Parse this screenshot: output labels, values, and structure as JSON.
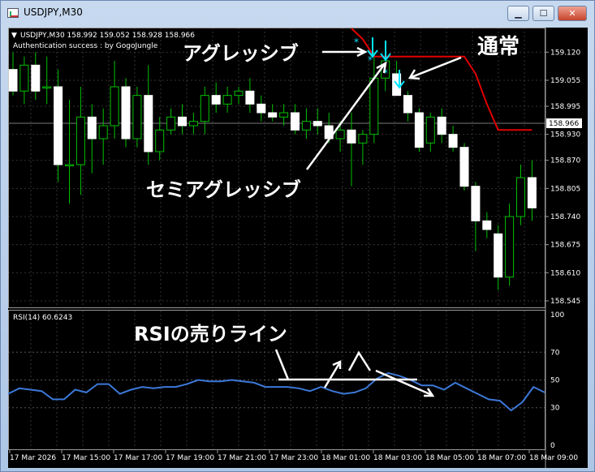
{
  "window": {
    "title": "USDJPY,M30",
    "buttons": {
      "minimize": "▁",
      "maximize": "☐",
      "close": "✕"
    }
  },
  "main_chart": {
    "header": "USDJPY,M30  158.992 159.052 158.928 158.966",
    "auth_text": "Authentication success : by GogoJungle",
    "current_price": "158.966",
    "price_ticks": [
      "159.120",
      "159.055",
      "158.995",
      "158.930",
      "158.870",
      "158.805",
      "158.740",
      "158.675",
      "158.610",
      "158.545"
    ]
  },
  "rsi_chart": {
    "header": "RSI(14) 60.6243",
    "ticks": [
      "100",
      "70",
      "50",
      "30",
      "0"
    ]
  },
  "time_axis": [
    "17 Mar 2026",
    "17 Mar 15:00",
    "17 Mar 17:00",
    "17 Mar 19:00",
    "17 Mar 21:00",
    "17 Mar 23:00",
    "18 Mar 01:00",
    "18 Mar 03:00",
    "18 Mar 05:00",
    "18 Mar 07:00",
    "18 Mar 09:00"
  ],
  "annotations": {
    "aggressive": "アグレッシブ",
    "normal": "通常",
    "semi_aggressive": "セミアグレッシブ",
    "rsi_sell_line": "RSIの売りライン"
  },
  "colors": {
    "background": "#000000",
    "grid": "#3a3a3a",
    "bull": "#ffffff",
    "wick": "#00c000",
    "ma_line": "#e00000",
    "rsi_line": "#3c78d8",
    "arrow": "#00e5ff"
  },
  "chart_data": [
    {
      "type": "candlestick",
      "title": "USDJPY,M30",
      "ylim": [
        158.53,
        159.175
      ],
      "candles": [
        {
          "o": 159.08,
          "h": 159.12,
          "l": 159.02,
          "c": 159.03
        },
        {
          "o": 159.03,
          "h": 159.11,
          "l": 159.0,
          "c": 159.09
        },
        {
          "o": 159.09,
          "h": 159.12,
          "l": 159.01,
          "c": 159.03
        },
        {
          "o": 159.04,
          "h": 159.11,
          "l": 159.0,
          "c": 159.04
        },
        {
          "o": 159.04,
          "h": 159.08,
          "l": 158.82,
          "c": 158.86
        },
        {
          "o": 158.86,
          "h": 159.01,
          "l": 158.77,
          "c": 158.86
        },
        {
          "o": 158.86,
          "h": 159.04,
          "l": 158.79,
          "c": 158.97
        },
        {
          "o": 158.97,
          "h": 159.0,
          "l": 158.84,
          "c": 158.92
        },
        {
          "o": 158.92,
          "h": 158.99,
          "l": 158.86,
          "c": 158.95
        },
        {
          "o": 158.95,
          "h": 159.1,
          "l": 158.92,
          "c": 159.04
        },
        {
          "o": 159.04,
          "h": 159.06,
          "l": 158.9,
          "c": 158.92
        },
        {
          "o": 158.92,
          "h": 159.04,
          "l": 158.9,
          "c": 159.02
        },
        {
          "o": 159.02,
          "h": 159.09,
          "l": 158.86,
          "c": 158.89
        },
        {
          "o": 158.89,
          "h": 158.97,
          "l": 158.87,
          "c": 158.94
        },
        {
          "o": 158.94,
          "h": 158.99,
          "l": 158.93,
          "c": 158.97
        },
        {
          "o": 158.97,
          "h": 159.0,
          "l": 158.93,
          "c": 158.95
        },
        {
          "o": 158.95,
          "h": 158.98,
          "l": 158.93,
          "c": 158.96
        },
        {
          "o": 158.96,
          "h": 159.04,
          "l": 158.93,
          "c": 159.02
        },
        {
          "o": 159.02,
          "h": 159.05,
          "l": 158.98,
          "c": 159.0
        },
        {
          "o": 159.0,
          "h": 159.04,
          "l": 158.98,
          "c": 159.02
        },
        {
          "o": 159.02,
          "h": 159.04,
          "l": 159.0,
          "c": 159.03
        },
        {
          "o": 159.03,
          "h": 159.06,
          "l": 158.98,
          "c": 159.0
        },
        {
          "o": 159.0,
          "h": 159.02,
          "l": 158.96,
          "c": 158.98
        },
        {
          "o": 158.98,
          "h": 159.0,
          "l": 158.96,
          "c": 158.97
        },
        {
          "o": 158.97,
          "h": 159.0,
          "l": 158.95,
          "c": 158.98
        },
        {
          "o": 158.98,
          "h": 159.0,
          "l": 158.93,
          "c": 158.94
        },
        {
          "o": 158.94,
          "h": 158.99,
          "l": 158.92,
          "c": 158.96
        },
        {
          "o": 158.96,
          "h": 158.99,
          "l": 158.93,
          "c": 158.95
        },
        {
          "o": 158.95,
          "h": 158.98,
          "l": 158.91,
          "c": 158.92
        },
        {
          "o": 158.92,
          "h": 158.96,
          "l": 158.89,
          "c": 158.94
        },
        {
          "o": 158.94,
          "h": 158.98,
          "l": 158.81,
          "c": 158.91
        },
        {
          "o": 158.91,
          "h": 158.94,
          "l": 158.86,
          "c": 158.93
        },
        {
          "o": 158.93,
          "h": 159.12,
          "l": 158.91,
          "c": 159.06
        },
        {
          "o": 159.06,
          "h": 159.14,
          "l": 159.03,
          "c": 159.1
        },
        {
          "o": 159.07,
          "h": 159.1,
          "l": 159.02,
          "c": 159.02
        },
        {
          "o": 159.02,
          "h": 159.03,
          "l": 158.96,
          "c": 158.98
        },
        {
          "o": 158.98,
          "h": 158.99,
          "l": 158.89,
          "c": 158.9
        },
        {
          "o": 158.91,
          "h": 158.98,
          "l": 158.89,
          "c": 158.97
        },
        {
          "o": 158.97,
          "h": 158.99,
          "l": 158.91,
          "c": 158.93
        },
        {
          "o": 158.93,
          "h": 158.95,
          "l": 158.89,
          "c": 158.9
        },
        {
          "o": 158.9,
          "h": 158.91,
          "l": 158.8,
          "c": 158.81
        },
        {
          "o": 158.81,
          "h": 158.82,
          "l": 158.66,
          "c": 158.73
        },
        {
          "o": 158.73,
          "h": 158.75,
          "l": 158.69,
          "c": 158.71
        },
        {
          "o": 158.7,
          "h": 158.72,
          "l": 158.57,
          "c": 158.6
        },
        {
          "o": 158.6,
          "h": 158.77,
          "l": 158.58,
          "c": 158.74
        },
        {
          "o": 158.74,
          "h": 158.86,
          "l": 158.72,
          "c": 158.83
        },
        {
          "o": 158.83,
          "h": 158.87,
          "l": 158.73,
          "c": 158.76
        }
      ],
      "ma_line": [
        {
          "i": 30,
          "v": 159.175
        },
        {
          "i": 31,
          "v": 159.15
        },
        {
          "i": 32,
          "v": 159.11
        },
        {
          "i": 33,
          "v": 159.11
        },
        {
          "i": 34,
          "v": 159.11
        },
        {
          "i": 35,
          "v": 159.11
        },
        {
          "i": 36,
          "v": 159.11
        },
        {
          "i": 37,
          "v": 159.11
        },
        {
          "i": 38,
          "v": 159.11
        },
        {
          "i": 39,
          "v": 159.11
        },
        {
          "i": 40,
          "v": 159.11
        },
        {
          "i": 41,
          "v": 159.07
        },
        {
          "i": 42,
          "v": 159.0
        },
        {
          "i": 43,
          "v": 158.94
        },
        {
          "i": 44,
          "v": 158.94
        },
        {
          "i": 45,
          "v": 158.94
        },
        {
          "i": 46,
          "v": 158.94
        }
      ]
    },
    {
      "type": "line",
      "title": "RSI(14)",
      "ylim": [
        0,
        100
      ],
      "series": [
        {
          "values": [
            40,
            44,
            43,
            42,
            36,
            36,
            43,
            41,
            47,
            47,
            40,
            43,
            45,
            44,
            45,
            45,
            47,
            50,
            49,
            49,
            50,
            49,
            48,
            45,
            45,
            45,
            44,
            42,
            45,
            42,
            40,
            41,
            44,
            51,
            55,
            53,
            50,
            46,
            46,
            43,
            48,
            44,
            40,
            36,
            35,
            28,
            34,
            45,
            41
          ]
        }
      ],
      "reference_levels": [
        70,
        50,
        30
      ]
    }
  ]
}
